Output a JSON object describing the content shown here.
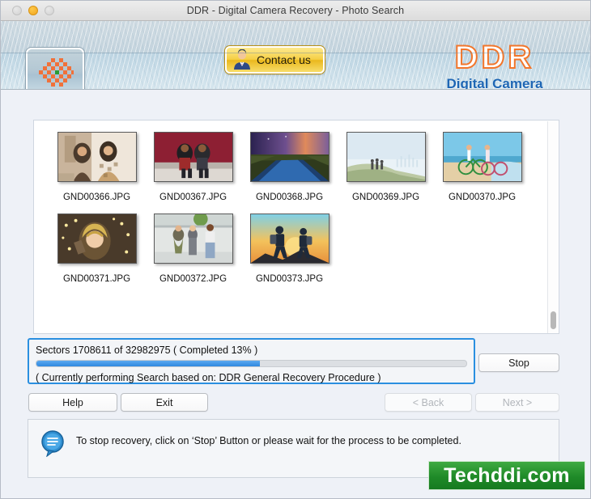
{
  "window": {
    "title": "DDR - Digital Camera Recovery - Photo Search",
    "traffic_lights": [
      "close-disabled",
      "minimize-amber",
      "zoom-disabled"
    ]
  },
  "header": {
    "app_icon_name": "checker-flower-icon",
    "contact_button": {
      "label": "Contact us",
      "icon": "person-icon"
    },
    "brand_title": "DDR",
    "brand_subtitle": "Digital Camera",
    "brand_title_color": "#f2762b",
    "brand_subtitle_color": "#1e66b4"
  },
  "thumbnails": {
    "rows": [
      [
        {
          "label": "GND00366.JPG",
          "alt": "two-women-sitting-indoors"
        },
        {
          "label": "GND00367.JPG",
          "alt": "two-boys-on-steps-red-wall"
        },
        {
          "label": "GND00368.JPG",
          "alt": "purple-sunset-field-road"
        },
        {
          "label": "GND00369.JPG",
          "alt": "family-on-hill-pale-sky"
        },
        {
          "label": "GND00370.JPG",
          "alt": "couple-cycling-on-beach"
        }
      ],
      [
        {
          "label": "GND00371.JPG",
          "alt": "woman-with-fairy-lights"
        },
        {
          "label": "GND00372.JPG",
          "alt": "three-women-standing"
        },
        {
          "label": "GND00373.JPG",
          "alt": "hikers-at-sunset"
        }
      ]
    ],
    "scrollbar_name": "vertical-scrollbar"
  },
  "progress": {
    "status_line": "Sectors 1708611 of 32982975   ( Completed 13% )",
    "sectors_done": 1708611,
    "sectors_total": 32982975,
    "percent_complete": 13,
    "bar_fill_percent": 52,
    "fill_color": "#2f88e0",
    "activity_line": "( Currently performing Search based on: DDR General Recovery Procedure )"
  },
  "buttons": {
    "stop": {
      "label": "Stop",
      "enabled": true
    },
    "help": {
      "label": "Help",
      "enabled": true
    },
    "exit": {
      "label": "Exit",
      "enabled": true
    },
    "back": {
      "label": "< Back",
      "enabled": false
    },
    "next": {
      "label": "Next >",
      "enabled": false
    }
  },
  "message": {
    "icon": "speech-bubble-icon",
    "text": "To stop recovery, click on ‘Stop’ Button or please wait for the process to be completed."
  },
  "watermark": {
    "text": "Techddi.com",
    "background_color": "#1f8a28"
  }
}
